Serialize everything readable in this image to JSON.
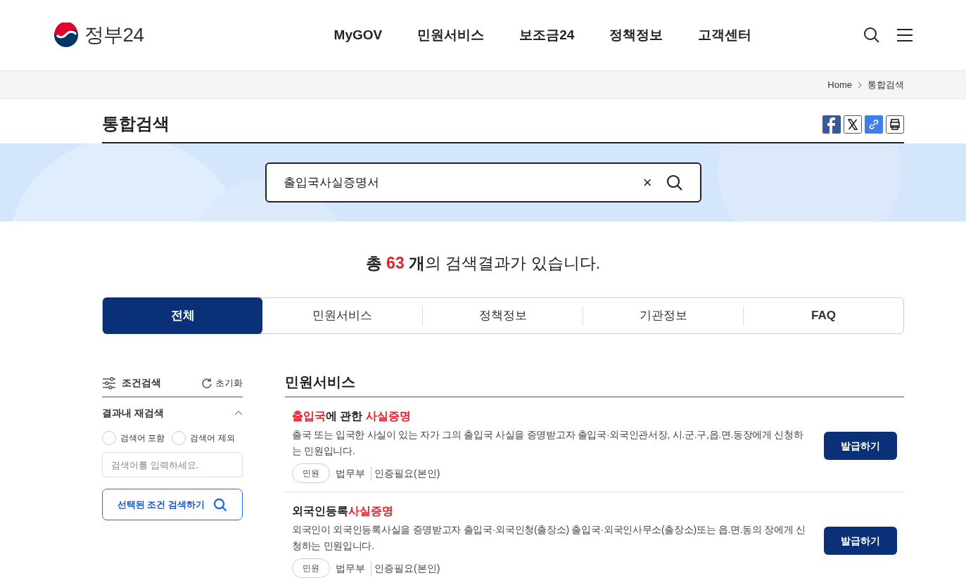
{
  "header": {
    "logo_text": "정부24",
    "nav": [
      "MyGOV",
      "민원서비스",
      "보조금24",
      "정책정보",
      "고객센터"
    ]
  },
  "breadcrumb": [
    "Home",
    "통합검색"
  ],
  "page_title": "통합검색",
  "search": {
    "value": "출입국사실증명서",
    "clear": "×"
  },
  "result_summary": {
    "prefix": "총",
    "count": "63",
    "unit": "개",
    "suffix": "의 검색결과가 있습니다."
  },
  "tabs": [
    {
      "label": "전체",
      "selected": true
    },
    {
      "label": "민원서비스",
      "selected": false
    },
    {
      "label": "정책정보",
      "selected": false
    },
    {
      "label": "기관정보",
      "selected": false
    },
    {
      "label": "FAQ",
      "selected": false
    }
  ],
  "sidebar": {
    "title": "조건검색",
    "reset": "초기화",
    "section": "결과내 재검색",
    "options": [
      {
        "label": "검색어 포함",
        "selected": false
      },
      {
        "label": "검색어 제외",
        "selected": false
      }
    ],
    "placeholder": "검색어를 입력하세요.",
    "submit": "선택된 조건 검색하기"
  },
  "results_section": {
    "title": "민원서비스",
    "items": [
      {
        "title": [
          {
            "text": "출입국",
            "highlight": true
          },
          {
            "text": "에 관한 ",
            "highlight": false
          },
          {
            "text": "사실증명",
            "highlight": true
          }
        ],
        "description": "출국 또는 입국한 사실이 있는 자가 그의 출입국 사실을 증명받고자 출입국·외국인관서장, 시.군.구,읍.면.동장에게 신청하는 민원입니다.",
        "tag": "민원",
        "agency": "법무부",
        "auth": "인증필요(본인)",
        "button": "발급하기"
      },
      {
        "title": [
          {
            "text": "외국인등록",
            "highlight": false
          },
          {
            "text": "사실증명",
            "highlight": true
          }
        ],
        "description": "외국인이 외국인등록사실을 증명받고자 출입국·외국인청(출장소) 출입국·외국인사무소(출장소)또는 읍.면.동의 장에게 신청하는 민원입니다.",
        "tag": "민원",
        "agency": "법무부",
        "auth": "인증필요(본인)",
        "button": "발급하기"
      }
    ]
  }
}
